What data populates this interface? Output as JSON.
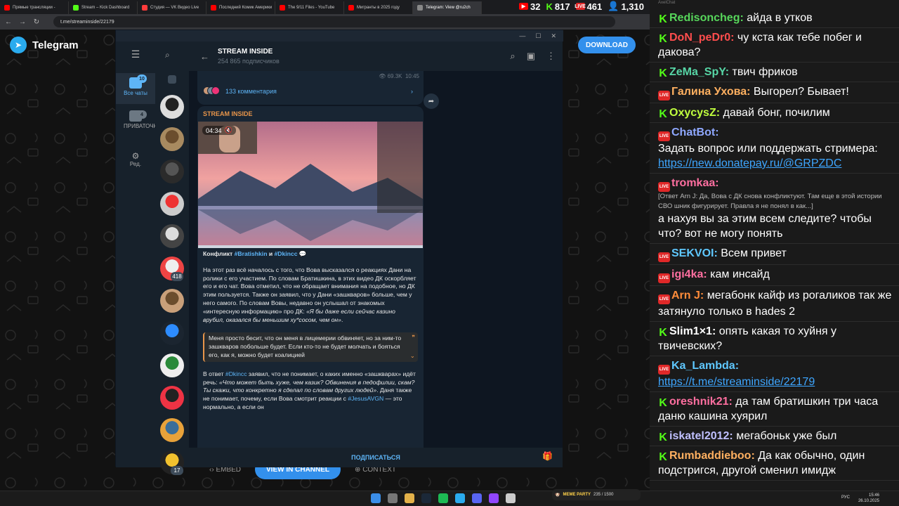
{
  "browser": {
    "tabs": [
      {
        "label": "Прямые трансляции -",
        "color": "#ff0000"
      },
      {
        "label": "Stream – Kick Dashboard",
        "color": "#53fc18"
      },
      {
        "label": "Студия — VK Видео Live",
        "color": "#ff3b3b"
      },
      {
        "label": "Последний Комик Америки",
        "color": "#ff0000"
      },
      {
        "label": "The 9/11 Files - YouTube",
        "color": "#ff0000"
      },
      {
        "label": "Мигранты в 2025 году",
        "color": "#ff0000"
      },
      {
        "label": "Telegram: View @ru2ch",
        "color": "#888888"
      }
    ],
    "url": "t.me/streaminside/22179",
    "stats": {
      "youtube": "32",
      "kick": "817",
      "vk": "461",
      "viewers": "1,310"
    }
  },
  "telegram": {
    "brand": "Telegram",
    "download": "DOWNLOAD",
    "embed": "EMBED",
    "view_in_channel": "VIEW IN CHANNEL",
    "context": "CONTEXT",
    "rail": {
      "all_chats": "Все чаты",
      "all_badge": "10",
      "private": "ПРИВАТОЧКА",
      "private_badge": "4",
      "edit": "Ред."
    },
    "chat_badges": {
      "b1": "418",
      "b2": "17"
    },
    "channel": {
      "name": "STREAM INSIDE",
      "subscribers": "254 865 подписчиков"
    },
    "prev_views": "69.3K",
    "prev_time": "10:45",
    "comments": "133 комментария",
    "post": {
      "sender": "STREAM INSIDE",
      "video_time": "04:34",
      "title_plain": "Конфликт ",
      "tag1": "#Bratishkin",
      "and": " и ",
      "tag2": "#Dkincc",
      "p1": "На этот раз всё началось с того, что Вова высказался о реакциях Дани на ролики с его участием. По словам Братишкина, в этих видео ДК оскорбляет его и его чат. Вова отметил, что не обращает внимания на подобное, но ДК этим пользуется. Также он заявил, что у Дани «зашкваров» больше, чем у него самого. По словам Вовы, недавно он услышал от знакомых «интересную информацию» про ДК: ",
      "p1_italic": "«Я бы даже если сейчас казино врубил, оказался бы меньшим ху*сосом, чем он»",
      "p1_end": ".",
      "quote": "Меня просто бесит, что он меня в лицемерии обвиняет, но за ним-то зашкваров побольше будет. Если кто-то не будет молчать и бояться его, как я, можно будет коалицией",
      "p2_start": "В ответ ",
      "p2_tag": "#Dkincc",
      "p2_mid": " заявил, что не понимает, о каких именно «зашкварах» идёт речь: ",
      "p2_italic": "«Что может быть хуже, чем казик? Обвинения в педофилии, скам? Ты скажи, что конкретно я сделал по словам других людей»",
      "p2_mid2": ". Даня также не понимает, почему, если Вова смотрит реакции с ",
      "p2_tag2": "#JesusAVGN",
      "p2_end": " — это нормально, а если он"
    },
    "subscribe": "ПОДПИСАТЬСЯ"
  },
  "chat": {
    "title": "AxelChat",
    "messages": [
      {
        "p": "kick",
        "user": "Redisoncheg",
        "color": "#57d65b",
        "text": "айда в утков"
      },
      {
        "p": "kick",
        "user": "DoN_peDr0",
        "color": "#ff4d4d",
        "text": "чу кста как тебе побег и дакова?"
      },
      {
        "p": "kick",
        "user": "ZeMa_SpY",
        "color": "#57d6a6",
        "text": "твич фриков"
      },
      {
        "p": "live",
        "user": "Галина Ухова",
        "color": "#ffb060",
        "text": "Выгорел? Бывает!"
      },
      {
        "p": "kick",
        "user": "OxycysZ",
        "color": "#c0ff3e",
        "text": "давай бонг, почилим"
      },
      {
        "p": "live",
        "user": "ChatBot",
        "color": "#8fa8ff",
        "text": "Задать вопрос или поддержать стримера:",
        "link": "https://new.donatepay.ru/@GRPZDC"
      },
      {
        "p": "live",
        "user": "tromkaa",
        "color": "#ff6fa0",
        "reply": "[Ответ Arn J: Да, Вова с ДК снова конфликтуют. Там еще в этой истории СВО шник фигурирует. Правла я не понял в как...]",
        "text": "а нахуя вы за этим всем следите? чтобы что? вот не могу понять"
      },
      {
        "p": "live",
        "user": "SEKVOI",
        "color": "#5fc8ff",
        "text": "Всем привет"
      },
      {
        "p": "live",
        "user": "igi4ka",
        "color": "#ff6fa0",
        "text": "кам инсайд"
      },
      {
        "p": "live",
        "user": "Arn J",
        "color": "#ff8c3a",
        "text": "мегабонк кайф из рогаликов так же затянуло только в hades 2"
      },
      {
        "p": "kick",
        "user": "Slim1×1",
        "color": "#ffffff",
        "text": "опять какая то хуйня у твичевских?"
      },
      {
        "p": "live",
        "user": "Ka_Lambda",
        "color": "#5fc8ff",
        "link": "https://t.me/streaminside/22179"
      },
      {
        "p": "kick",
        "user": "oreshnik21",
        "color": "#ff6fa0",
        "text": "да там братишкин три часа даню кашина хуярил"
      },
      {
        "p": "kick",
        "user": "iskatel2012",
        "color": "#c0c0ff",
        "text": "мегабоньк уже был"
      },
      {
        "p": "kick",
        "user": "Rumbaddieboo",
        "color": "#ffb060",
        "text": "Да как обычно, один подстригся, другой сменил имидж"
      }
    ]
  },
  "taskbar": {
    "lang": "РУС",
    "time": "15:46",
    "date": "26.10.2025",
    "meme": "MEME PARTY",
    "meme_count": "235 / 1500"
  }
}
